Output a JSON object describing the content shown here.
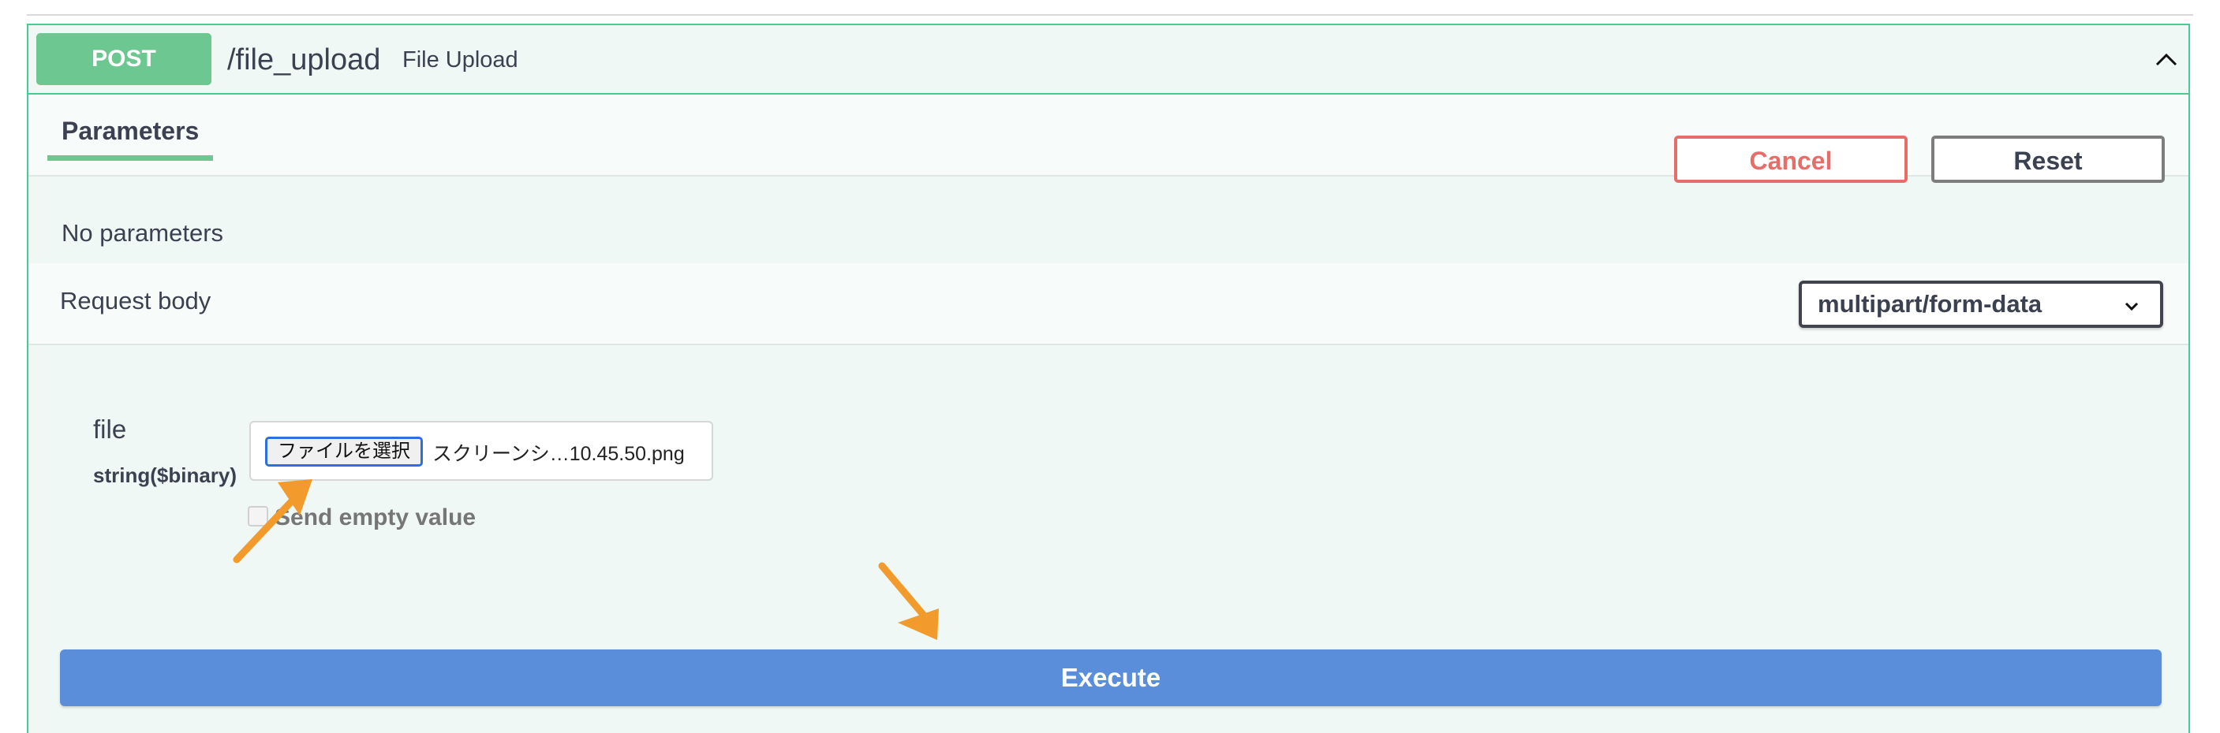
{
  "operation": {
    "method": "POST",
    "path": "/file_upload",
    "summary": "File Upload"
  },
  "tabs": {
    "parameters_label": "Parameters"
  },
  "actions": {
    "cancel_label": "Cancel",
    "reset_label": "Reset"
  },
  "parameters": {
    "empty_text": "No parameters"
  },
  "request_body": {
    "label": "Request body",
    "content_type": "multipart/form-data"
  },
  "file_param": {
    "name": "file",
    "type": "string($binary)",
    "choose_button_label": "ファイルを選択",
    "selected_file_name": "スクリーンシ…10.45.50.png",
    "send_empty_label": "Send empty value"
  },
  "execute": {
    "label": "Execute"
  },
  "colors": {
    "post_green": "#49cc90",
    "method_badge": "#6cc890",
    "cancel_red": "#e86d68",
    "execute_blue": "#5a8edb",
    "annotation_orange": "#f39a2c"
  },
  "icons": {
    "collapse": "chevron-up-icon",
    "select_caret": "chevron-down-icon",
    "annotations": [
      "arrow-annotation-icon",
      "arrow-annotation-icon"
    ]
  }
}
